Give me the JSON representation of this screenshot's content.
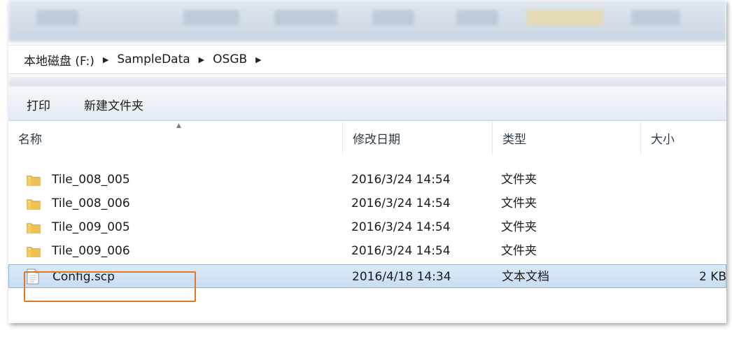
{
  "breadcrumb": [
    "本地磁盘 (F:)",
    "SampleData",
    "OSGB"
  ],
  "commands": {
    "print": "打印",
    "new_folder": "新建文件夹"
  },
  "columns": {
    "name": "名称",
    "modified": "修改日期",
    "type": "类型",
    "size": "大小"
  },
  "files": [
    {
      "name": "Tile_008_005",
      "modified": "2016/3/24 14:54",
      "type": "文件夹",
      "size": "",
      "icon": "folder-icon"
    },
    {
      "name": "Tile_008_006",
      "modified": "2016/3/24 14:54",
      "type": "文件夹",
      "size": "",
      "icon": "folder-icon"
    },
    {
      "name": "Tile_009_005",
      "modified": "2016/3/24 14:54",
      "type": "文件夹",
      "size": "",
      "icon": "folder-icon"
    },
    {
      "name": "Tile_009_006",
      "modified": "2016/3/24 14:54",
      "type": "文件夹",
      "size": "",
      "icon": "folder-icon"
    },
    {
      "name": "Config.scp",
      "modified": "2016/4/18 14:34",
      "type": "文本文档",
      "size": "2 KB",
      "icon": "text-file-icon",
      "selected": true
    }
  ],
  "colors": {
    "highlight": "#e07a22",
    "selection": "#c8ddf3"
  }
}
